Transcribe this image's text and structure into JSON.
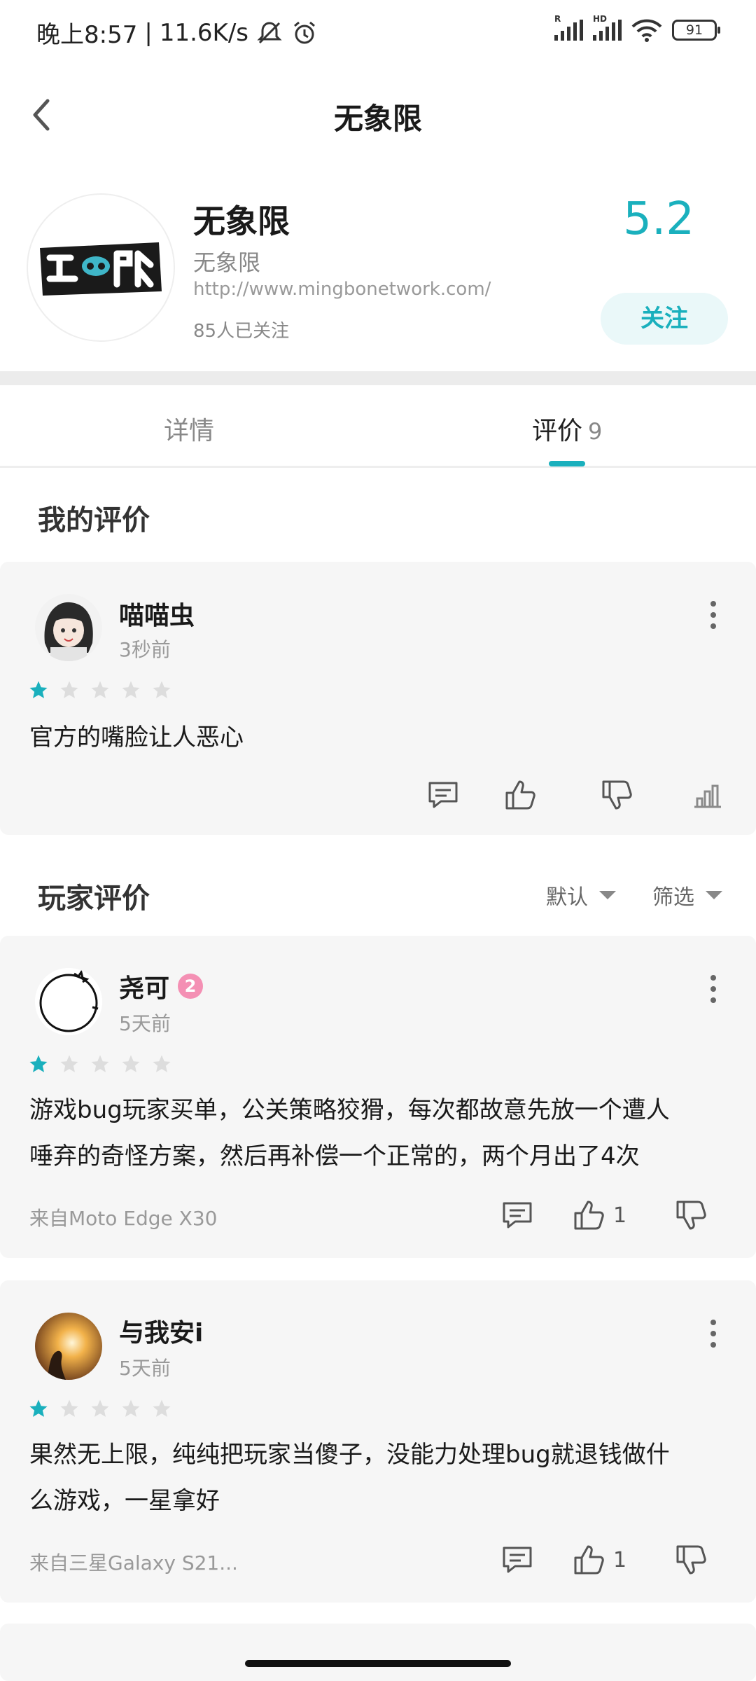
{
  "status_bar": {
    "time": "晚上8:57",
    "speed": "11.6K/s",
    "signal1_tag": "R",
    "signal2_tag": "HD",
    "battery": "91"
  },
  "header": {
    "title": "无象限"
  },
  "game": {
    "name": "无象限",
    "developer": "无象限",
    "url": "http://www.mingbonetwork.com/",
    "followers": "85人已关注",
    "score": "5.2",
    "follow_label": "关注"
  },
  "tabs": [
    {
      "label": "详情",
      "count": ""
    },
    {
      "label": "评价",
      "count": "9"
    }
  ],
  "my_review": {
    "section_title": "我的评价",
    "user": "喵喵虫",
    "time": "3秒前",
    "rating": 1,
    "content": "官方的嘴脸让人恶心"
  },
  "player_reviews": {
    "section_title": "玩家评价",
    "sort_label": "默认",
    "filter_label": "筛选",
    "items": [
      {
        "user": "尧可",
        "level": "2",
        "time": "5天前",
        "rating": 1,
        "content_line1": "游戏bug玩家买单，公关策略狡猾，每次都故意先放一个遭人",
        "content_line2": "唾弃的奇怪方案，然后再补偿一个正常的，两个月出了4次",
        "device": "来自Moto Edge X30",
        "likes": "1"
      },
      {
        "user": "与我安i",
        "time": "5天前",
        "rating": 1,
        "content_line1": "果然无上限，纯纯把玩家当傻子，没能力处理bug就退钱做什",
        "content_line2": "么游戏，一星拿好",
        "device": "来自三星Galaxy S21...",
        "likes": "1"
      }
    ]
  },
  "colors": {
    "accent": "#1ab0bd",
    "card_bg": "#f6f6f6",
    "star_off": "#dddddd"
  }
}
